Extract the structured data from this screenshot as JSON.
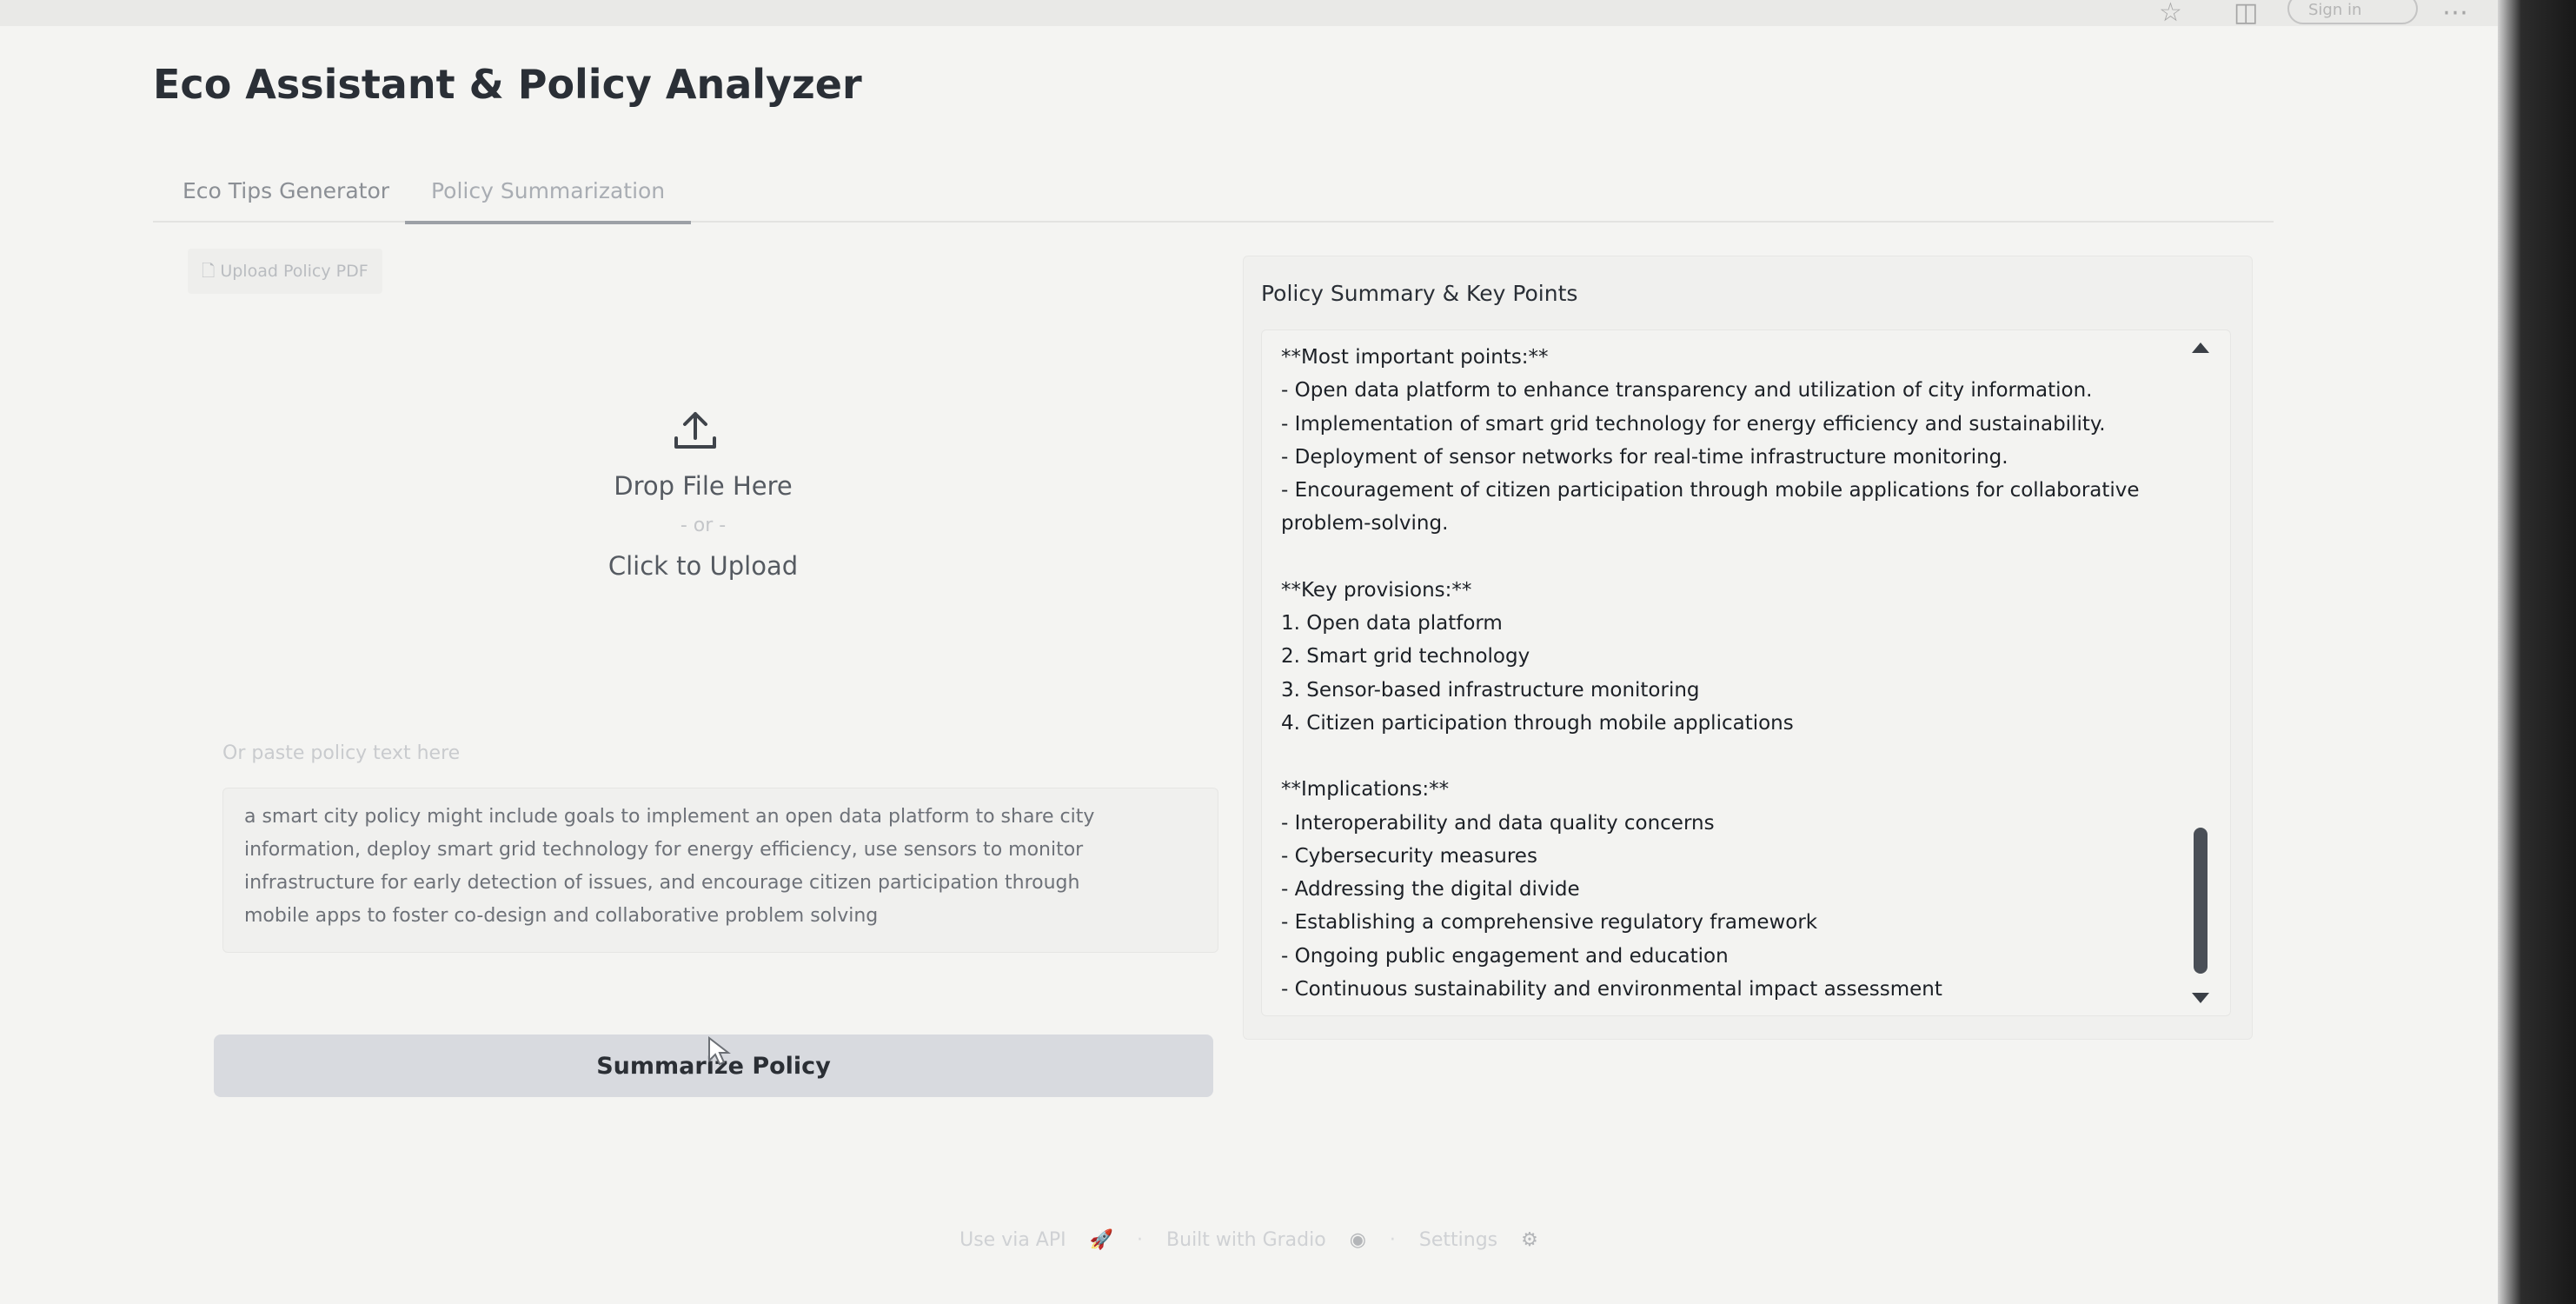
{
  "browser": {
    "signin_label": "Sign in"
  },
  "app": {
    "title": "Eco Assistant & Policy Analyzer",
    "tabs": [
      {
        "label": "Eco Tips Generator",
        "active": false
      },
      {
        "label": "Policy Summarization",
        "active": true
      }
    ]
  },
  "upload": {
    "label": "Upload Policy PDF",
    "icon": "upload-icon",
    "drop_text": "Drop File Here",
    "or_text": "- or -",
    "click_text": "Click to Upload"
  },
  "paste": {
    "label": "Or paste policy text here",
    "lines": [
      "a smart city policy might include goals to implement an open data platform to share city",
      "information, deploy smart grid technology for energy efficiency, use sensors to monitor",
      "infrastructure for early detection of issues, and encourage citizen participation through",
      "mobile apps to foster co-design and collaborative problem solving"
    ]
  },
  "summarize_button": "Summarize Policy",
  "summary": {
    "label": "Policy Summary & Key Points",
    "lines": [
      "**Most important points:**",
      "- Open data platform to enhance transparency and utilization of city information.",
      "- Implementation of smart grid technology for energy efficiency and sustainability.",
      "- Deployment of sensor networks for real-time infrastructure monitoring.",
      "- Encouragement of citizen participation through mobile applications for collaborative",
      "problem-solving.",
      "",
      "**Key provisions:**",
      "1. Open data platform",
      "2. Smart grid technology",
      "3. Sensor-based infrastructure monitoring",
      "4. Citizen participation through mobile applications",
      "",
      "**Implications:**",
      "- Interoperability and data quality concerns",
      "- Cybersecurity measures",
      "- Addressing the digital divide",
      "- Establishing a comprehensive regulatory framework",
      "- Ongoing public engagement and education",
      "- Continuous sustainability and environmental impact assessment"
    ]
  },
  "footer": {
    "api": "Use via API",
    "sep": "·",
    "built": "Built with Gradio",
    "settings": "Settings"
  }
}
